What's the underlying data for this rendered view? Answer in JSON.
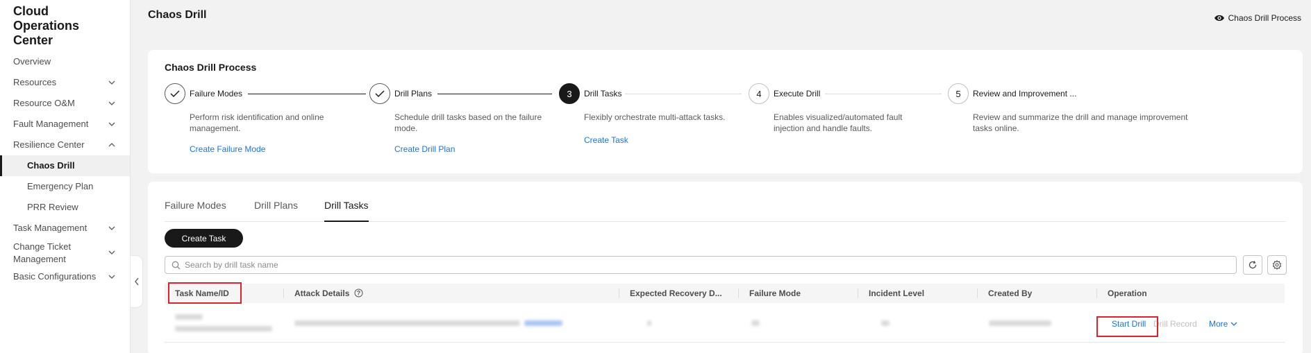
{
  "app": {
    "title": "Cloud Operations Center"
  },
  "sidebar": {
    "items": [
      {
        "label": "Overview"
      },
      {
        "label": "Resources"
      },
      {
        "label": "Resource O&M"
      },
      {
        "label": "Fault Management"
      },
      {
        "label": "Resilience Center"
      },
      {
        "label": "Chaos Drill"
      },
      {
        "label": "Emergency Plan"
      },
      {
        "label": "PRR Review"
      },
      {
        "label": "Task Management"
      },
      {
        "label": "Change Ticket Management"
      },
      {
        "label": "Basic Configurations"
      }
    ]
  },
  "header": {
    "title": "Chaos Drill",
    "process_link": "Chaos Drill Process"
  },
  "process": {
    "title": "Chaos Drill Process",
    "steps": [
      {
        "title": "Failure Modes",
        "desc": "Perform risk identification and online management.",
        "link": "Create Failure Mode"
      },
      {
        "title": "Drill Plans",
        "desc": "Schedule drill tasks based on the failure mode.",
        "link": "Create Drill Plan"
      },
      {
        "number": "3",
        "title": "Drill Tasks",
        "desc": "Flexibly orchestrate multi-attack tasks.",
        "link": "Create Task"
      },
      {
        "number": "4",
        "title": "Execute Drill",
        "desc": "Enables visualized/automated fault injection and handle faults."
      },
      {
        "number": "5",
        "title": "Review and Improvement ...",
        "desc": "Review and summarize the drill and manage improvement tasks online."
      }
    ]
  },
  "tabs": [
    {
      "label": "Failure Modes"
    },
    {
      "label": "Drill Plans"
    },
    {
      "label": "Drill Tasks"
    }
  ],
  "toolbar": {
    "create_label": "Create Task"
  },
  "search": {
    "placeholder": "Search by drill task name"
  },
  "table": {
    "columns": [
      "Task Name/ID",
      "Attack Details",
      "Expected Recovery D...",
      "Failure Mode",
      "Incident Level",
      "Created By",
      "Operation"
    ],
    "row": {
      "ops": [
        "Start Drill",
        "Drill Record",
        "More"
      ]
    }
  },
  "colors": {
    "accent": "#1a73e8",
    "highlight": "#e0202b",
    "primary": "#191919"
  }
}
